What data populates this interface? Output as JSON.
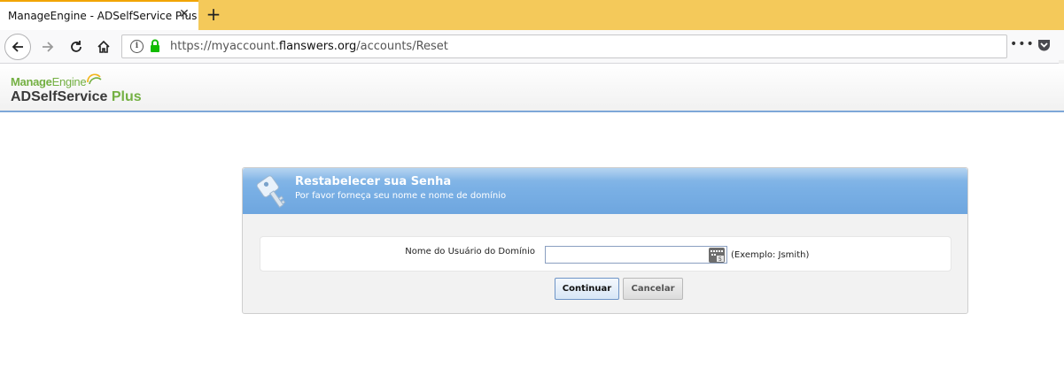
{
  "browser": {
    "tab_title": "ManageEngine - ADSelfService Plus",
    "tab_close": "✕",
    "new_tab": "+",
    "url_prefix": "https://myaccount.",
    "url_domain": "flanswers.org",
    "url_path": "/accounts/Reset",
    "more_label": "•••",
    "icons": [
      "back-arrow-icon",
      "forward-arrow-icon",
      "reload-icon",
      "home-icon",
      "info-icon",
      "lock-icon",
      "more-icon",
      "pocket-icon"
    ],
    "accent_color": "#f4c95a"
  },
  "app": {
    "brand_top": "Manage",
    "brand_top_2": "Engine",
    "brand_bottom": "ADSelfService",
    "brand_bottom_2": " Plus",
    "brand_color": "#74b043"
  },
  "dialog": {
    "title": "Restabelecer sua Senha",
    "subtitle": "Por favor forneça seu nome e nome de domínio",
    "field_label": "Nome do Usuário do Domínio",
    "field_value": "",
    "field_hint": "(Exemplo: Jsmith)",
    "continue_label": "Continuar",
    "cancel_label": "Cancelar",
    "header_color": "#7ab0e5"
  }
}
